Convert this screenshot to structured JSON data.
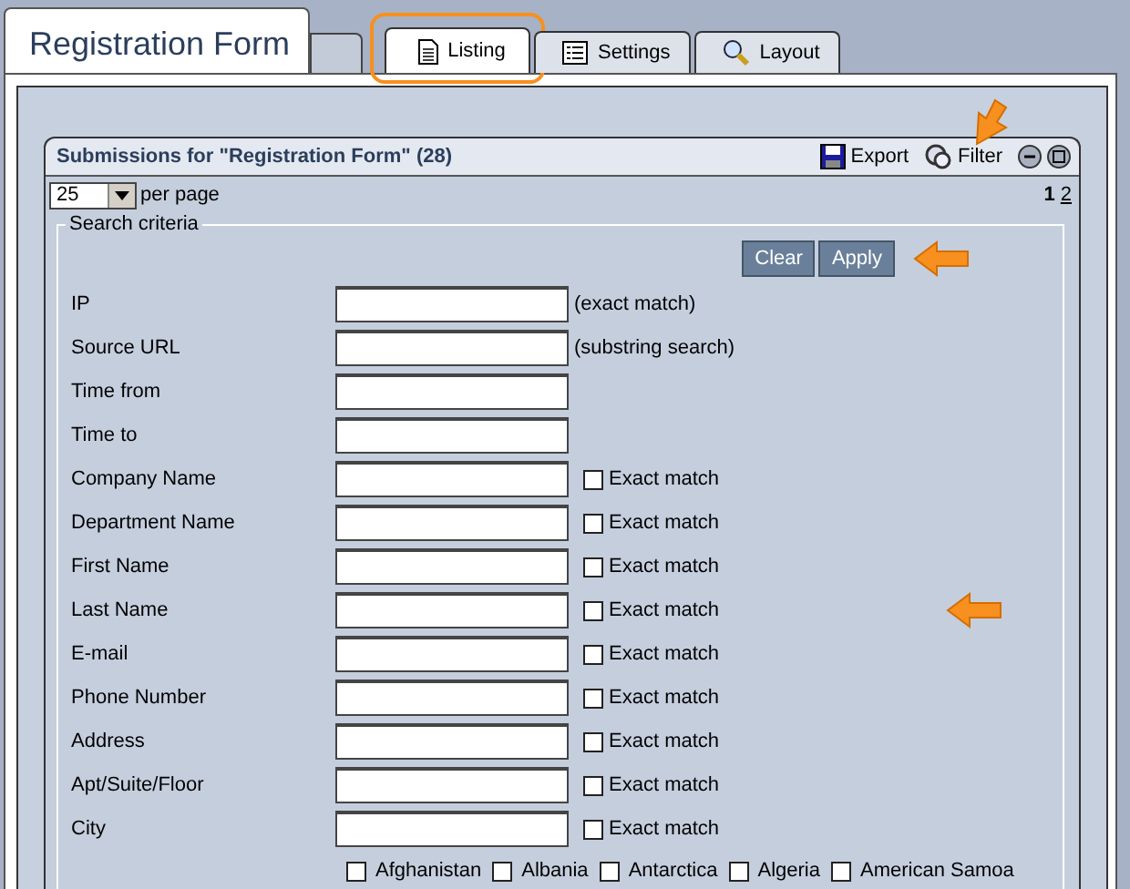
{
  "title_tab": {
    "label": "Registration Form"
  },
  "tabs": [
    {
      "label": "Listing",
      "selected": true,
      "highlighted": true
    },
    {
      "label": "Settings",
      "selected": false,
      "highlighted": false
    },
    {
      "label": "Layout",
      "selected": false,
      "highlighted": false
    }
  ],
  "panel": {
    "title": "Submissions for \"Registration Form\" (28)",
    "actions": [
      {
        "label": "Export",
        "pointed": false
      },
      {
        "label": "Filter",
        "pointed": true
      }
    ]
  },
  "per_page": {
    "value": "25",
    "label": "per page"
  },
  "pages": [
    {
      "label": "1",
      "selected": true
    },
    {
      "label": "2",
      "selected": false
    }
  ],
  "search": {
    "legend": "Search criteria",
    "buttons": [
      "Clear",
      "Apply"
    ],
    "buttons_pointed": true,
    "side_pointer": true,
    "fields": [
      {
        "label": "IP",
        "kind": "note",
        "note": "(exact match)"
      },
      {
        "label": "Source URL",
        "kind": "note",
        "note": "(substring search)"
      },
      {
        "label": "Time from",
        "kind": "plain"
      },
      {
        "label": "Time to",
        "kind": "plain"
      },
      {
        "label": "Company Name",
        "kind": "exact",
        "exact": {
          "label": "Exact match",
          "checked": false
        }
      },
      {
        "label": "Department Name",
        "kind": "exact",
        "exact": {
          "label": "Exact match",
          "checked": false
        }
      },
      {
        "label": "First Name",
        "kind": "exact",
        "exact": {
          "label": "Exact match",
          "checked": false
        }
      },
      {
        "label": "Last Name",
        "kind": "exact",
        "exact": {
          "label": "Exact match",
          "checked": false
        }
      },
      {
        "label": "E-mail",
        "kind": "exact",
        "exact": {
          "label": "Exact match",
          "checked": false
        }
      },
      {
        "label": "Phone Number",
        "kind": "exact",
        "exact": {
          "label": "Exact match",
          "checked": false
        }
      },
      {
        "label": "Address",
        "kind": "exact",
        "exact": {
          "label": "Exact match",
          "checked": false
        }
      },
      {
        "label": "Apt/Suite/Floor",
        "kind": "exact",
        "exact": {
          "label": "Exact match",
          "checked": false
        }
      },
      {
        "label": "City",
        "kind": "exact",
        "exact": {
          "label": "Exact match",
          "checked": false
        }
      }
    ],
    "countries": [
      {
        "label": "Afghanistan",
        "checked": false
      },
      {
        "label": "Albania",
        "checked": false
      },
      {
        "label": "Antarctica",
        "checked": false
      },
      {
        "label": "Algeria",
        "checked": false
      },
      {
        "label": "American Samoa",
        "checked": false
      }
    ]
  }
}
